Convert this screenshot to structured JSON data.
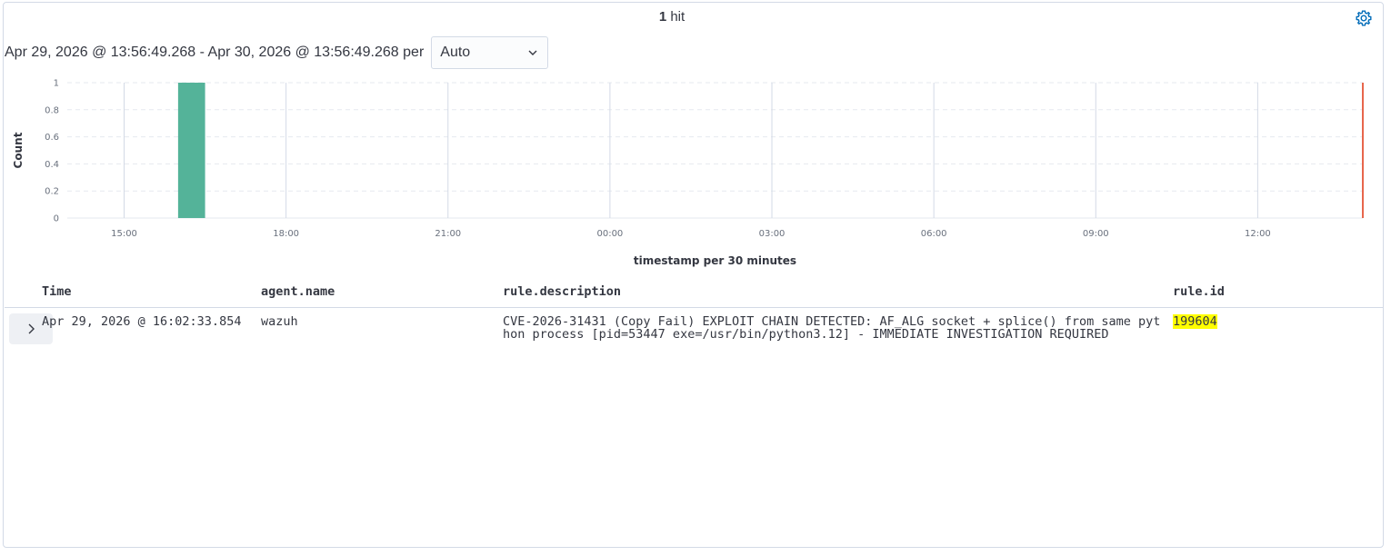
{
  "header": {
    "hit_count": "1",
    "hit_label": "hit",
    "settings_icon": "gear-icon"
  },
  "time_range": {
    "text": "Apr 29, 2026 @ 13:56:49.268 - Apr 30, 2026 @ 13:56:49.268 per",
    "interval_selected": "Auto",
    "dropdown_icon": "chevron-down-icon"
  },
  "chart_data": {
    "type": "bar",
    "ylabel": "Count",
    "xlabel": "timestamp per 30 minutes",
    "ylim": [
      0,
      1
    ],
    "y_ticks": [
      "0",
      "0.2",
      "0.4",
      "0.6",
      "0.8",
      "1"
    ],
    "x_ticks": [
      "15:00",
      "18:00",
      "21:00",
      "00:00",
      "03:00",
      "06:00",
      "09:00",
      "12:00"
    ],
    "x_range_hours": [
      "Apr 29, 2026 13:56:49.268",
      "Apr 30, 2026 13:56:49.268"
    ],
    "bars": [
      {
        "start": "16:00",
        "end": "16:30",
        "value": 1
      }
    ],
    "bar_color": "#54b399",
    "current_time_marker_color": "#e7664c",
    "grid": true
  },
  "table": {
    "columns": [
      "Time",
      "agent.name",
      "rule.description",
      "rule.id"
    ],
    "rows": [
      {
        "time": "Apr 29, 2026 @ 16:02:33.854",
        "agent_name": "wazuh",
        "rule_description": "CVE-2026-31431 (Copy Fail) EXPLOIT CHAIN DETECTED: AF_ALG socket + splice() from same python process [pid=53447 exe=/usr/bin/python3.12] - IMMEDIATE INVESTIGATION REQUIRED",
        "rule_id": "199604"
      }
    ],
    "expand_icon": "chevron-right-icon",
    "highlight_color": "#ffff00"
  }
}
